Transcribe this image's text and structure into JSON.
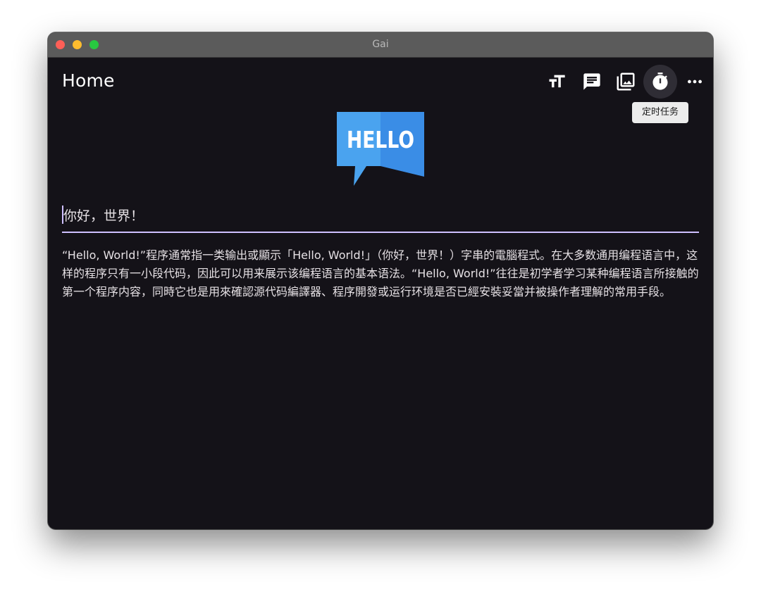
{
  "window": {
    "title": "Gai"
  },
  "appbar": {
    "title": "Home",
    "actions": [
      {
        "icon": "text-size-icon"
      },
      {
        "icon": "chat-message-icon"
      },
      {
        "icon": "photo-library-icon"
      },
      {
        "icon": "timer-icon"
      },
      {
        "icon": "more-horizontal-icon"
      }
    ],
    "tooltip": "定时任务"
  },
  "logo": {
    "text": "HELLO",
    "color_light": "#4aa3ef",
    "color_dark": "#3a8de6"
  },
  "input": {
    "value": "你好，世界！"
  },
  "content": {
    "paragraph": "“Hello, World!”程序通常指一类输出或顯示「Hello, World!」（你好，世界！）字串的電腦程式。在大多数通用编程语言中，这样的程序只有一小段代码，因此可以用来展示该编程语言的基本语法。“Hello, World!”往往是初学者学习某种编程语言所接触的第一个程序内容，同時它也是用來確認源代码編譯器、程序開發或运行环境是否已經安裝妥當并被操作者理解的常用手段。"
  },
  "colors": {
    "background": "#141218",
    "titlebar": "#5b5b5b",
    "accent": "#cfc0ff",
    "text": "#e6e1e5"
  }
}
